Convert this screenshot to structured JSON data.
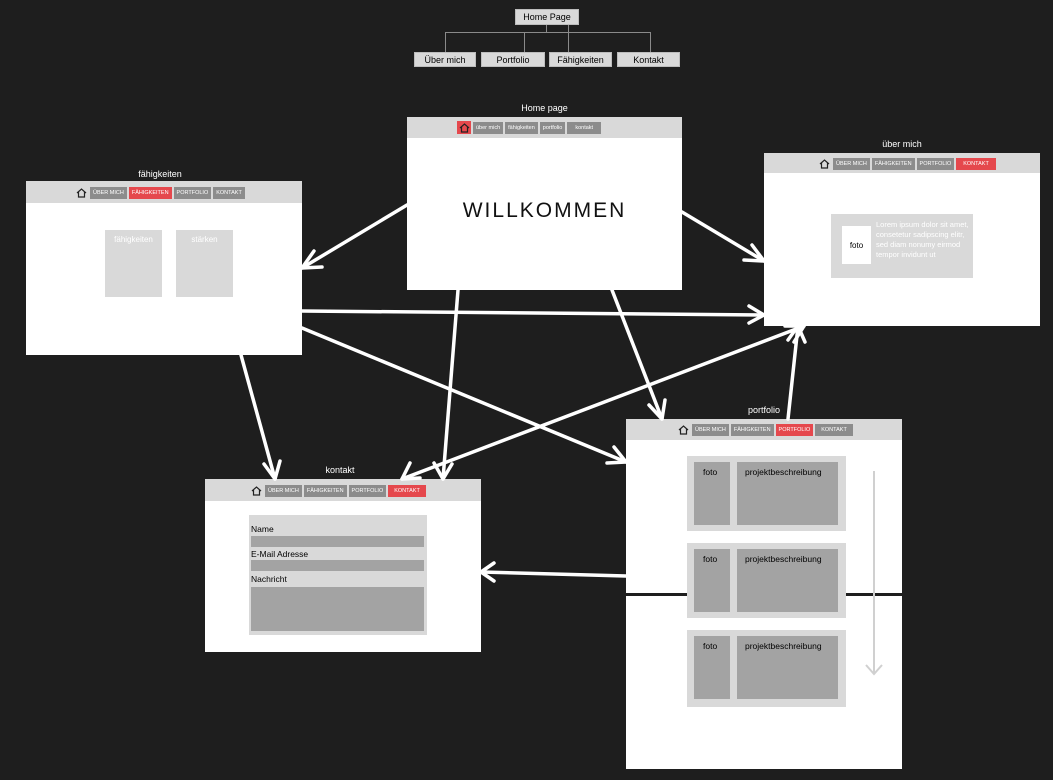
{
  "sitemap": {
    "root": "Home Page",
    "children": [
      "Über mich",
      "Portfolio",
      "Fähigkeiten",
      "Kontakt"
    ]
  },
  "frames": {
    "home": {
      "title": "Home page",
      "nav": [
        "über mich",
        "fähigkeiten",
        "portfolio",
        "kontakt"
      ],
      "heading": "WILLKOMMEN"
    },
    "faehigkeiten": {
      "title": "fähigkeiten",
      "nav": [
        "ÜBER MICH",
        "FÄHIGKEITEN",
        "PORTFOLIO",
        "KONTAKT"
      ],
      "box1": "fähigkeiten",
      "box2": "stärken"
    },
    "ueber": {
      "title": "über mich",
      "nav": [
        "ÜBER MICH",
        "FÄHIGKEITEN",
        "PORTFOLIO",
        "KONTAKT"
      ],
      "photo": "foto",
      "lorem": "Lorem ipsum dolor sit amet, consetetur sadipscing elitr, sed diam nonumy eirmod tempor invidunt ut"
    },
    "kontakt": {
      "title": "kontakt",
      "nav": [
        "ÜBER MICH",
        "FÄHIGKEITEN",
        "PORTFOLIO",
        "KONTAKT"
      ],
      "name_label": "Name",
      "email_label": "E-Mail Adresse",
      "message_label": "Nachricht"
    },
    "portfolio": {
      "title": "portfolio",
      "nav": [
        "ÜBER MICH",
        "FÄHIGKEITEN",
        "PORTFOLIO",
        "KONTAKT"
      ],
      "cards": [
        {
          "photo": "foto",
          "desc": "projektbeschreibung"
        },
        {
          "photo": "foto",
          "desc": "projektbeschreibung"
        },
        {
          "photo": "foto",
          "desc": "projektbeschreibung"
        }
      ]
    }
  },
  "colors": {
    "background": "#1e1e1e",
    "accent": "#e5484d",
    "panel": "#d9d9d9",
    "button": "#8c8c8c"
  }
}
